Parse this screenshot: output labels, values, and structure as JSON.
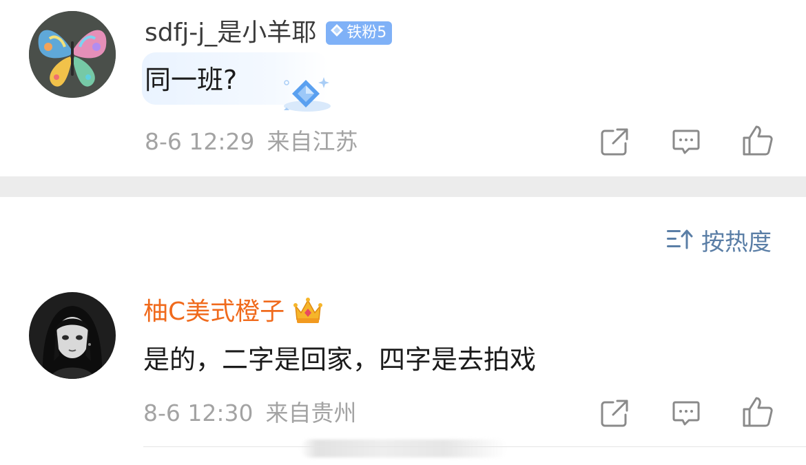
{
  "comments": [
    {
      "avatar": "butterfly-avatar",
      "username": "sdfj-j_是小羊耶",
      "badge": {
        "icon": "diamond-icon",
        "text": "铁粉5",
        "color": "#7fb1f7"
      },
      "text": "同一班?",
      "time": "8-6 12:29",
      "location": "来自江苏",
      "actions": [
        "share-icon",
        "comment-icon",
        "like-icon"
      ]
    },
    {
      "avatar": "anime-girl-avatar",
      "username": "柚C美式橙子",
      "badge": {
        "icon": "crown-icon"
      },
      "text": "是的，二字是回家，四字是去拍戏",
      "time": "8-6 12:30",
      "location": "来自贵州",
      "actions": [
        "share-icon",
        "comment-icon",
        "like-icon"
      ]
    }
  ],
  "sort": {
    "icon": "sort-icon",
    "label": "按热度"
  },
  "colors": {
    "username_orange": "#f06a1c",
    "badge_blue": "#7fb1f7",
    "sort_blue": "#5a7ea6",
    "meta_gray": "#a3a3a3",
    "divider_gray": "#ececec"
  }
}
